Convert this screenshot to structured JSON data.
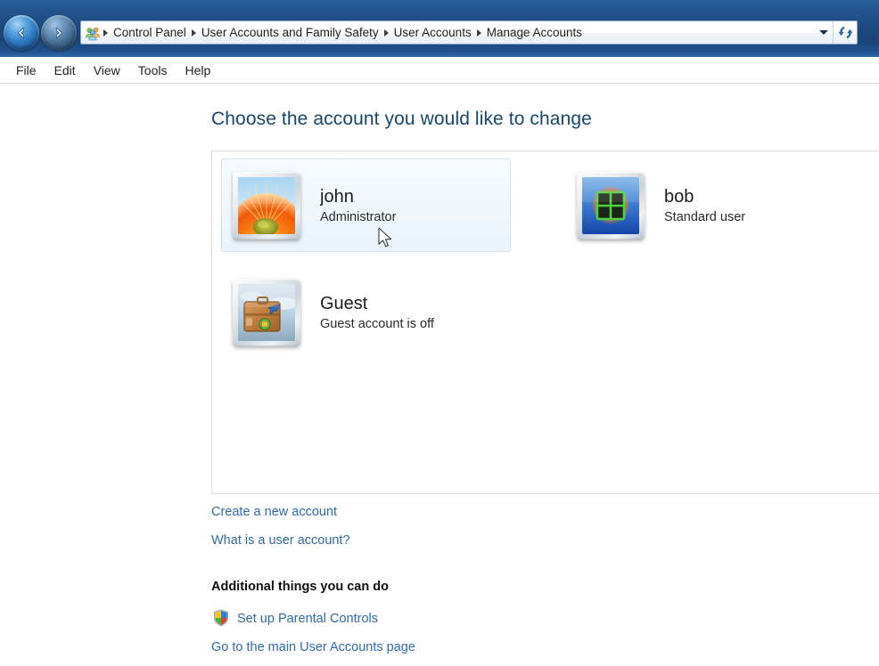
{
  "window": {
    "nav": {
      "back_label": "Back",
      "forward_label": "Forward",
      "recent_pages_label": "Recent pages",
      "back_icon": "arrow-left-icon",
      "forward_icon": "arrow-right-icon"
    },
    "address_bar": {
      "icon": "user-accounts-icon",
      "crumbs": [
        {
          "label": "Control Panel"
        },
        {
          "label": "User Accounts and Family Safety"
        },
        {
          "label": "User Accounts"
        },
        {
          "label": "Manage Accounts"
        }
      ],
      "dropdown_icon": "chevron-down-icon",
      "refresh_icon": "refresh-icon",
      "refresh_label": "Refresh"
    },
    "menubar": {
      "items": [
        {
          "label": "File"
        },
        {
          "label": "Edit"
        },
        {
          "label": "View"
        },
        {
          "label": "Tools"
        },
        {
          "label": "Help"
        }
      ]
    }
  },
  "main": {
    "page_title": "Choose the account you would like to change",
    "accounts": [
      {
        "name": "john",
        "role": "Administrator",
        "avatar": "flower-avatar-icon",
        "selected": true
      },
      {
        "name": "bob",
        "role": "Standard user",
        "avatar": "window-avatar-icon",
        "selected": false
      },
      {
        "name": "Guest",
        "role": "Guest account is off",
        "avatar": "suitcase-avatar-icon",
        "selected": false
      }
    ],
    "links": {
      "create_account": "Create a new account",
      "what_is_account": "What is a user account?"
    },
    "additional": {
      "heading": "Additional things you can do",
      "parental_controls": "Set up Parental Controls",
      "parental_icon": "uac-shield-icon",
      "main_page": "Go to the main User Accounts page"
    }
  },
  "colors": {
    "titlebar": "#1d4a82",
    "heading": "#17486b",
    "link": "#2f6ba8",
    "selected_tile": "#eaf3fb",
    "panel_border": "#dcdcdc"
  }
}
